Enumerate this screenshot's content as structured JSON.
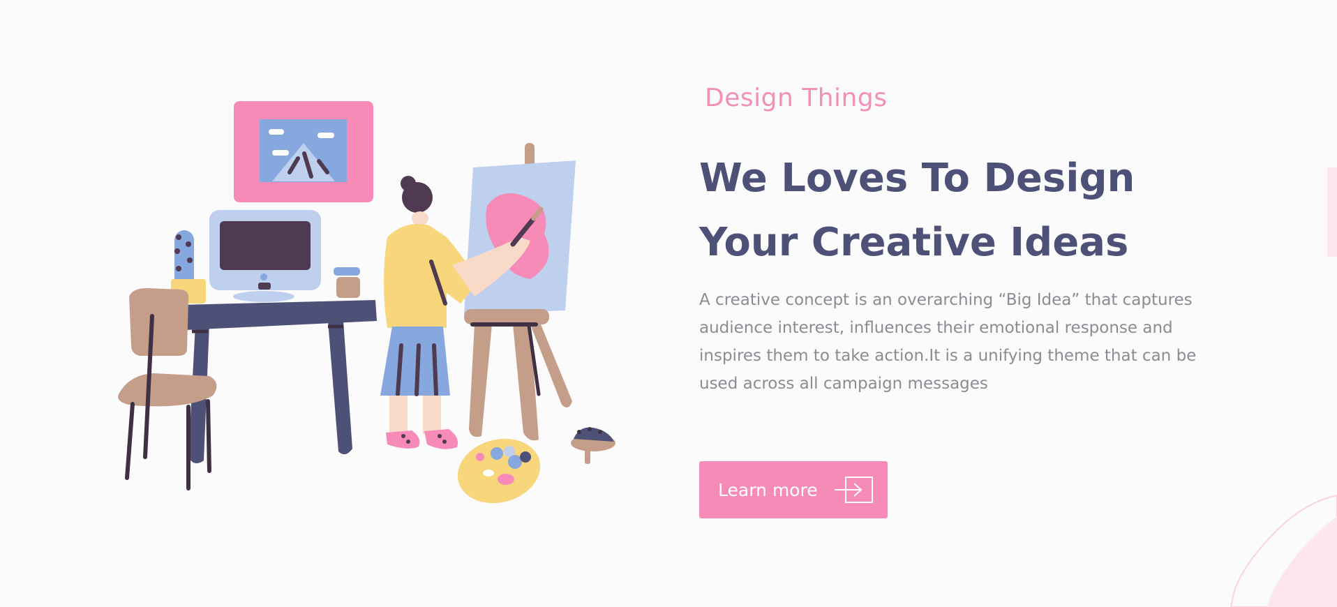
{
  "eyebrow": "Design Things",
  "title_line1": "We Loves To Design",
  "title_line2": "Your Creative Ideas",
  "description": "A creative concept is an overarching “Big Idea” that captures audience interest, influences their emotional response and inspires them to take action.It is a unifying theme that can be used across all campaign messages",
  "cta": {
    "label": "Learn more",
    "icon": "arrow-right-box-icon"
  },
  "colors": {
    "accent": "#f68bb7",
    "heading": "#4e5177",
    "body_text": "#8c8b92",
    "background": "#fcfbfc"
  }
}
